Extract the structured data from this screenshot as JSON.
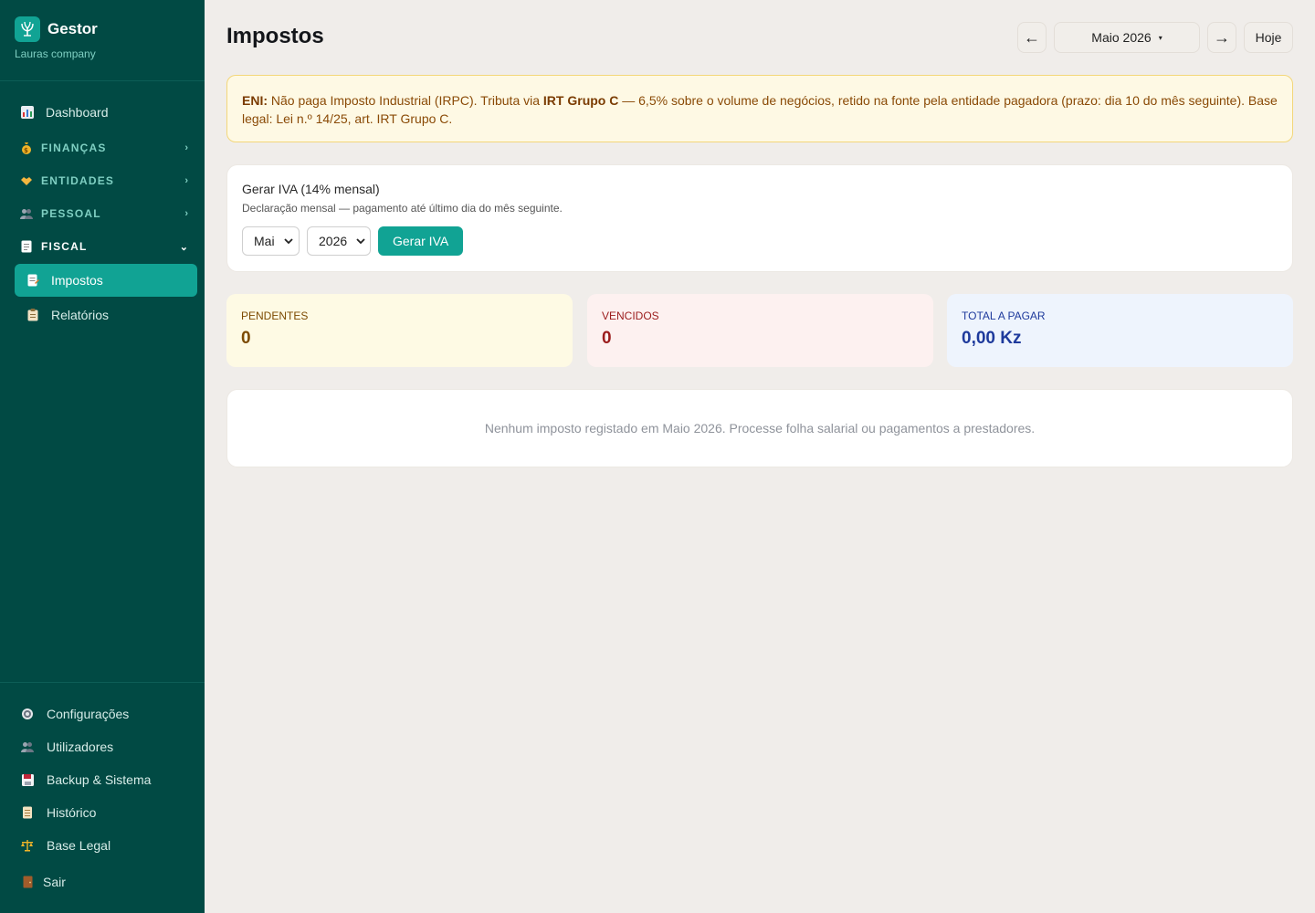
{
  "brand": {
    "name": "Gestor",
    "company": "Lauras company"
  },
  "nav": {
    "dashboard": "Dashboard",
    "financas": "FINANÇAS",
    "entidades": "ENTIDADES",
    "pessoal": "PESSOAL",
    "fiscal": "FISCAL",
    "impostos": "Impostos",
    "relatorios": "Relatórios"
  },
  "bottom_nav": {
    "configuracoes": "Configurações",
    "utilizadores": "Utilizadores",
    "backup": "Backup & Sistema",
    "historico": "Histórico",
    "base_legal": "Base Legal",
    "sair": "Sair"
  },
  "header": {
    "title": "Impostos",
    "prev": "←",
    "month": "Maio 2026",
    "caret": "▾",
    "next": "→",
    "today": "Hoje"
  },
  "notice": {
    "lead": "ENI:",
    "text1": " Não paga Imposto Industrial (IRPC). Tributa via ",
    "bold": "IRT Grupo C",
    "text2": " — 6,5% sobre o volume de negócios, retido na fonte pela entidade pagadora (prazo: dia 10 do mês seguinte). Base legal: Lei n.º 14/25, art. IRT Grupo C."
  },
  "iva": {
    "title": "Gerar IVA (14% mensal)",
    "subtitle": "Declaração mensal — pagamento até último dia do mês seguinte.",
    "month_value": "Mai",
    "year_value": "2026",
    "button": "Gerar IVA"
  },
  "stats": {
    "pendentes_label": "PENDENTES",
    "pendentes_value": "0",
    "vencidos_label": "VENCIDOS",
    "vencidos_value": "0",
    "total_label": "TOTAL A PAGAR",
    "total_value": "0,00 Kz"
  },
  "empty_message": "Nenhum imposto registado em Maio 2026. Processe folha salarial ou pagamentos a prestadores.",
  "colors": {
    "sidebar_bg": "#014a44",
    "accent": "#11a394",
    "notice_bg": "#fef9e4",
    "pendentes_bg": "#fefae4",
    "vencidos_bg": "#fdf1f0",
    "total_bg": "#eef4fd"
  }
}
